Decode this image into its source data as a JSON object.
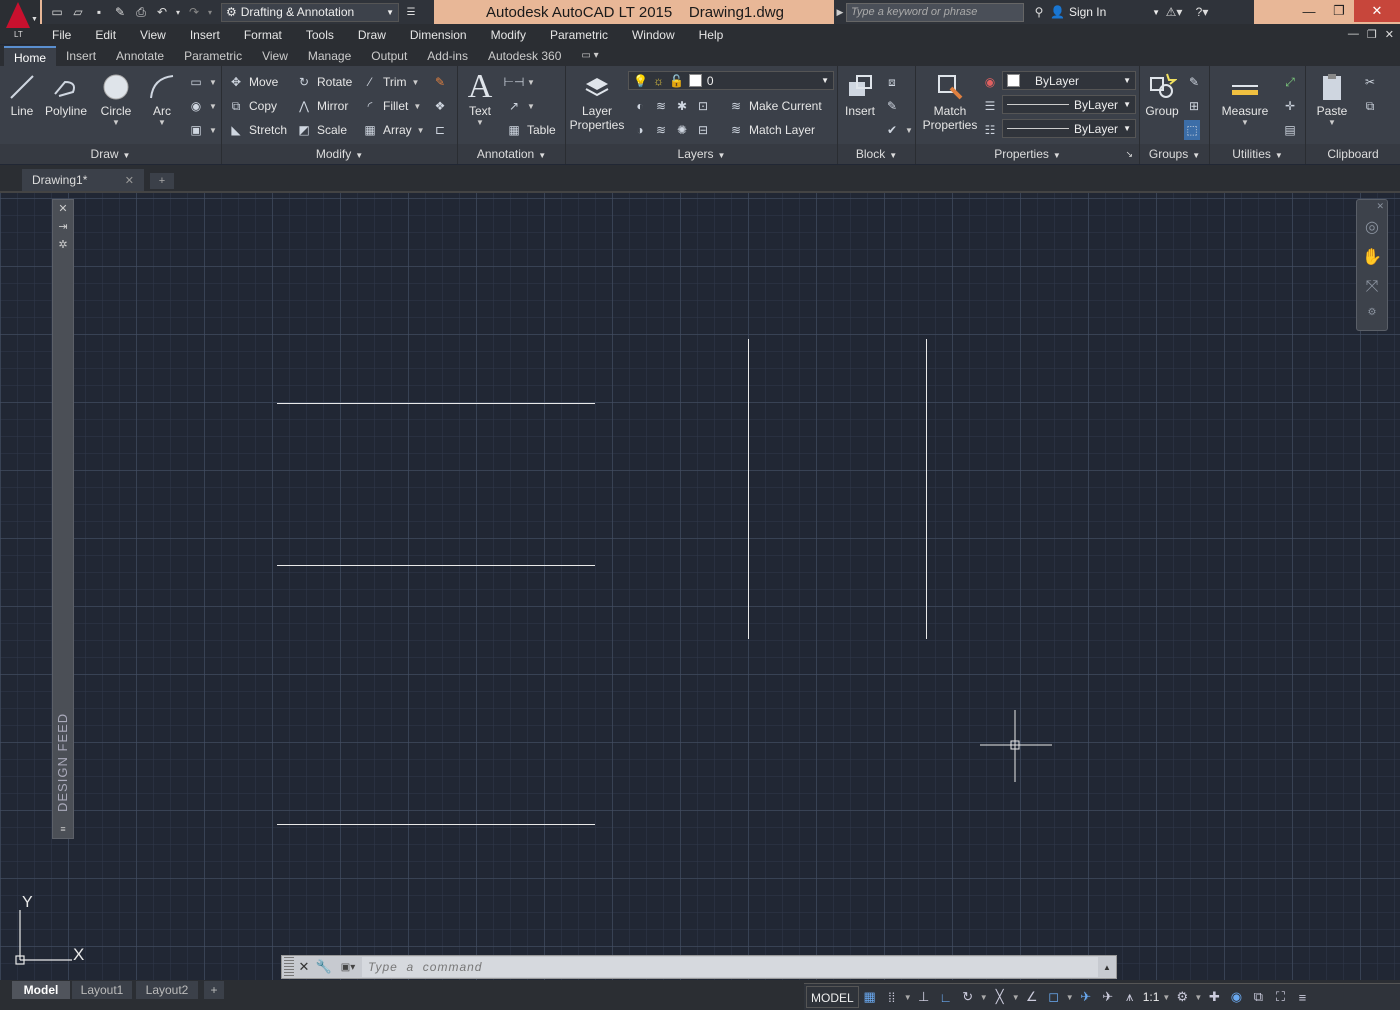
{
  "app": {
    "logo_text": "LT",
    "title": "Autodesk AutoCAD LT 2015",
    "document": "Drawing1.dwg",
    "workspace": "Drafting & Annotation"
  },
  "search": {
    "placeholder": "Type a keyword or phrase"
  },
  "account": {
    "sign_in": "Sign In"
  },
  "menu": [
    "File",
    "Edit",
    "View",
    "Insert",
    "Format",
    "Tools",
    "Draw",
    "Dimension",
    "Modify",
    "Parametric",
    "Window",
    "Help"
  ],
  "ribbon_tabs": [
    "Home",
    "Insert",
    "Annotate",
    "Parametric",
    "View",
    "Manage",
    "Output",
    "Add-ins",
    "Autodesk 360"
  ],
  "ribbon": {
    "draw": {
      "title": "Draw",
      "line": "Line",
      "polyline": "Polyline",
      "circle": "Circle",
      "arc": "Arc"
    },
    "modify": {
      "title": "Modify",
      "move": "Move",
      "rotate": "Rotate",
      "trim": "Trim",
      "copy": "Copy",
      "mirror": "Mirror",
      "fillet": "Fillet",
      "stretch": "Stretch",
      "scale": "Scale",
      "array": "Array"
    },
    "annotation": {
      "title": "Annotation",
      "text": "Text",
      "table": "Table"
    },
    "layers": {
      "title": "Layers",
      "layer_properties_1": "Layer",
      "layer_properties_2": "Properties",
      "current_layer": "0",
      "make_current": "Make Current",
      "match_layer": "Match Layer"
    },
    "block": {
      "title": "Block",
      "insert": "Insert"
    },
    "properties": {
      "title": "Properties",
      "match_1": "Match",
      "match_2": "Properties",
      "color": "ByLayer",
      "lineweight": "ByLayer",
      "linetype": "ByLayer"
    },
    "groups": {
      "title": "Groups",
      "group": "Group"
    },
    "utilities": {
      "title": "Utilities",
      "measure": "Measure"
    },
    "clipboard": {
      "title": "Clipboard",
      "paste": "Paste"
    }
  },
  "file_tabs": {
    "active": "Drawing1*"
  },
  "design_feed": {
    "label": "DESIGN FEED"
  },
  "ucs": {
    "x_label": "X",
    "y_label": "Y"
  },
  "command_line": {
    "placeholder": "Type  a  command"
  },
  "layout_tabs": [
    "Model",
    "Layout1",
    "Layout2"
  ],
  "status": {
    "model": "MODEL",
    "scale": "1:1"
  },
  "colors": {
    "canvas": "#212734",
    "title_bar": "#e8b797",
    "ribbon": "#3b4049",
    "accent": "#5a8fd0"
  }
}
